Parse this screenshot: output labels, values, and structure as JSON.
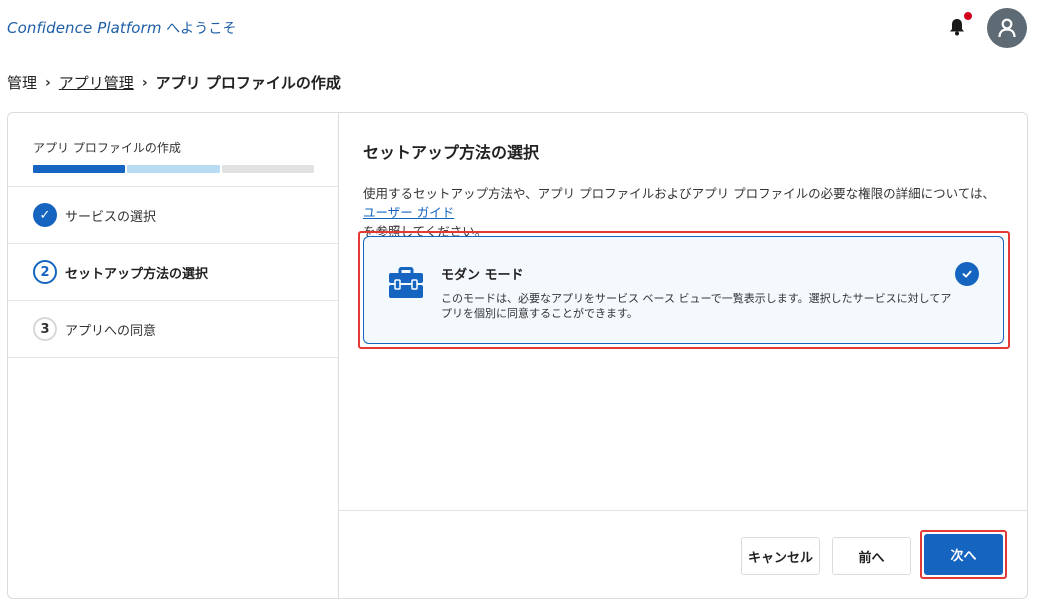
{
  "header": {
    "app_title": "Confidence Platform",
    "welcome": " へようこそ"
  },
  "breadcrumb": {
    "items": [
      "管理",
      "アプリ管理",
      "アプリ プロファイルの作成"
    ]
  },
  "wizard": {
    "progress_title": "アプリ プロファイルの作成",
    "progress_step": 1,
    "progress_total": 3,
    "steps": [
      {
        "marker": "✓",
        "label": "サービスの選択",
        "state": "done"
      },
      {
        "marker": "2",
        "label": "セットアップ方法の選択",
        "state": "current"
      },
      {
        "marker": "3",
        "label": "アプリへの同意",
        "state": "todo"
      }
    ]
  },
  "main": {
    "title": "セットアップ方法の選択",
    "desc_before": "使用するセットアップ方法や、アプリ プロファイルおよびアプリ プロファイルの必要な権限の詳細については、",
    "desc_link": "ユーザー ガイド",
    "desc_after": "を参照してください。",
    "mode": {
      "icon": "toolbox-icon",
      "title": "モダン モード",
      "description": "このモードは、必要なアプリをサービス ベース ビューで一覧表示します。選択したサービスに対してアプリを個別に同意することができます。",
      "selected": true
    }
  },
  "buttons": {
    "cancel": "キャンセル",
    "prev": "前へ",
    "next": "次へ"
  },
  "colors": {
    "accent": "#1565c0",
    "highlight": "#e53935",
    "notification": "#d0021b"
  }
}
